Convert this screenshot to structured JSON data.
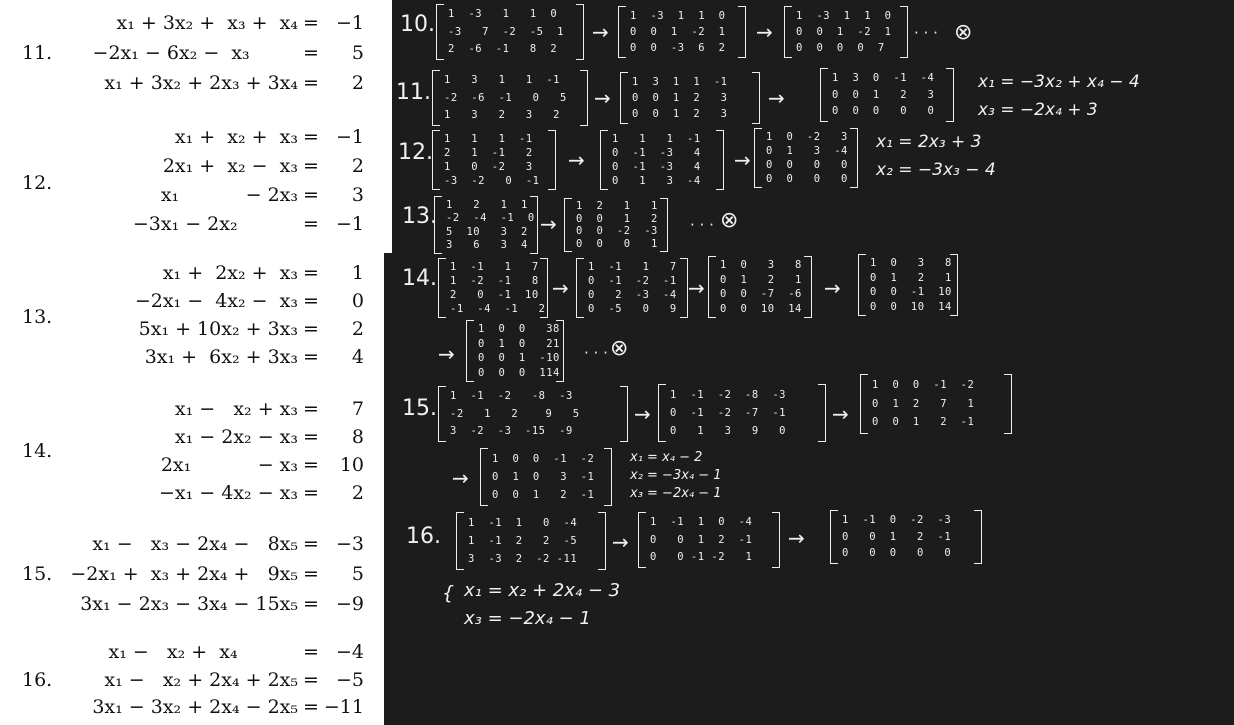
{
  "printed": {
    "p11": {
      "number": "11.",
      "lines": [
        {
          "lhs": "x₁ + 3x₂ +  x₃ +  x₄",
          "eq": "=",
          "rhs": "−1"
        },
        {
          "lhs": "−2x₁ − 6x₂ −  x₃        ",
          "eq": "=",
          "rhs": "5"
        },
        {
          "lhs": "x₁ + 3x₂ + 2x₃ + 3x₄",
          "eq": "=",
          "rhs": "2"
        }
      ]
    },
    "p12": {
      "number": "12.",
      "lines": [
        {
          "lhs": "x₁ +  x₂ +  x₃",
          "eq": "=",
          "rhs": "−1"
        },
        {
          "lhs": "2x₁ +  x₂ −  x₃",
          "eq": "=",
          "rhs": "2"
        },
        {
          "lhs": "x₁           − 2x₃",
          "eq": "=",
          "rhs": "3"
        },
        {
          "lhs": "−3x₁ − 2x₂          ",
          "eq": "=",
          "rhs": "−1"
        }
      ]
    },
    "p13": {
      "number": "13.",
      "lines": [
        {
          "lhs": "x₁ +  2x₂ +  x₃",
          "eq": "=",
          "rhs": "1"
        },
        {
          "lhs": "−2x₁ −  4x₂ −  x₃",
          "eq": "=",
          "rhs": "0"
        },
        {
          "lhs": "5x₁ + 10x₂ + 3x₃",
          "eq": "=",
          "rhs": "2"
        },
        {
          "lhs": "3x₁ +  6x₂ + 3x₃",
          "eq": "=",
          "rhs": "4"
        }
      ]
    },
    "p14": {
      "number": "14.",
      "lines": [
        {
          "lhs": "x₁ −   x₂ + x₃",
          "eq": "=",
          "rhs": "7"
        },
        {
          "lhs": "x₁ − 2x₂ − x₃",
          "eq": "=",
          "rhs": "8"
        },
        {
          "lhs": "2x₁           − x₃",
          "eq": "=",
          "rhs": "10"
        },
        {
          "lhs": "−x₁ − 4x₂ − x₃",
          "eq": "=",
          "rhs": "2"
        }
      ]
    },
    "p15": {
      "number": "15.",
      "lines": [
        {
          "lhs": "x₁ −   x₃ − 2x₄ −   8x₅",
          "eq": "=",
          "rhs": "−3"
        },
        {
          "lhs": "−2x₁ +  x₃ + 2x₄ +   9x₅",
          "eq": "=",
          "rhs": "5"
        },
        {
          "lhs": "3x₁ − 2x₃ − 3x₄ − 15x₅",
          "eq": "=",
          "rhs": "−9"
        }
      ]
    },
    "p16": {
      "number": "16.",
      "lines": [
        {
          "lhs": "x₁ −   x₂ +  x₄          ",
          "eq": "=",
          "rhs": "−4"
        },
        {
          "lhs": "x₁ −   x₂ + 2x₄ + 2x₅",
          "eq": "=",
          "rhs": "−5"
        },
        {
          "lhs": "3x₁ − 3x₂ + 2x₄ − 2x₅",
          "eq": "=",
          "rhs": "−11"
        }
      ]
    }
  },
  "handwritten": {
    "n10": "10.",
    "n11": "11.",
    "n12": "12.",
    "n13": "13.",
    "n14": "14.",
    "n15": "15.",
    "n16": "16.",
    "arrow": "→",
    "dots": "· · ·",
    "xmark": "⊗",
    "m10a": [
      "1  -3   1   1  0",
      "-3   7  -2  -5  1",
      "2  -6  -1   8  2"
    ],
    "m10b": [
      "1  -3  1  1  0",
      "0  0  1  -2  1",
      "0  0  -3  6  2"
    ],
    "m10c": [
      "1  -3  1  1  0",
      "0  0  1  -2  1",
      "0  0  0  0  7"
    ],
    "m11a": [
      "1   3   1   1  -1",
      "-2  -6  -1   0   5",
      "1   3   2   3   2"
    ],
    "m11b": [
      "1  3  1  1  -1",
      "0  0  1  2   3",
      "0  0  1  2   3"
    ],
    "m11c": [
      "1  3  0  -1  -4",
      "0  0  1   2   3",
      "0  0  0   0   0"
    ],
    "s11a": "x₁ = −3x₂ + x₄ − 4",
    "s11b": "x₃ = −2x₄ + 3",
    "m12a": [
      "1   1   1  -1",
      "2   1  -1   2",
      "1   0  -2   3",
      "-3  -2   0  -1"
    ],
    "m12b": [
      "1   1   1  -1",
      "0  -1  -3   4",
      "0  -1  -3   4",
      "0   1   3  -4"
    ],
    "m12c": [
      "1  0  -2   3",
      "0  1   3  -4",
      "0  0   0   0",
      "0  0   0   0"
    ],
    "s12a": "x₁ = 2x₃ + 3",
    "s12b": "x₂ = −3x₃ − 4",
    "m13a": [
      "1   2   1  1",
      "-2  -4  -1  0",
      "5  10   3  2",
      "3   6   3  4"
    ],
    "m13b": [
      "1  2   1   1",
      "0  0   1   2",
      "0  0  -2  -3",
      "0  0   0   1"
    ],
    "m14a": [
      "1  -1   1   7",
      "1  -2  -1   8",
      "2   0  -1  10",
      "-1  -4  -1   2"
    ],
    "m14b": [
      "1  -1   1   7",
      "0  -1  -2  -1",
      "0   2  -3  -4",
      "0  -5   0   9"
    ],
    "m14c": [
      "1  0   3   8",
      "0  1   2   1",
      "0  0  -7  -6",
      "0  0  10  14"
    ],
    "m14d": [
      "1  0   3   8",
      "0  1   2   1",
      "0  0  -1  10",
      "0  0  10  14"
    ],
    "m14e": [
      "1  0  0   38",
      "0  1  0   21",
      "0  0  1  -10",
      "0  0  0  114"
    ],
    "m15a": [
      "1  -1  -2   -8  -3",
      "-2   1   2    9   5",
      "3  -2  -3  -15  -9"
    ],
    "m15b": [
      "1  -1  -2  -8  -3",
      "0  -1  -2  -7  -1",
      "0   1   3   9   0"
    ],
    "m15c": [
      "1  0  0  -1  -2",
      "0  1  2   7   1",
      "0  0  1   2  -1"
    ],
    "m15d": [
      "1  0  0  -1  -2",
      "0  1  0   3  -1",
      "0  0  1   2  -1"
    ],
    "s15a": "x₁ = x₄ − 2",
    "s15b": "x₂ = −3x₄ − 1",
    "s15c": "x₃ = −2x₄ − 1",
    "m16a": [
      "1  -1  1   0  -4",
      "1  -1  2   2  -5",
      "3  -3  2  -2 -11"
    ],
    "m16b": [
      "1  -1  1  0  -4",
      "0   0  1  2  -1",
      "0   0 -1 -2   1"
    ],
    "m16c": [
      "1  -1  0  -2  -3",
      "0   0  1   2  -1",
      "0   0  0   0   0"
    ],
    "s16a": "x₁ = x₂ + 2x₄ − 3",
    "s16b": "x₃ = −2x₄ − 1"
  }
}
